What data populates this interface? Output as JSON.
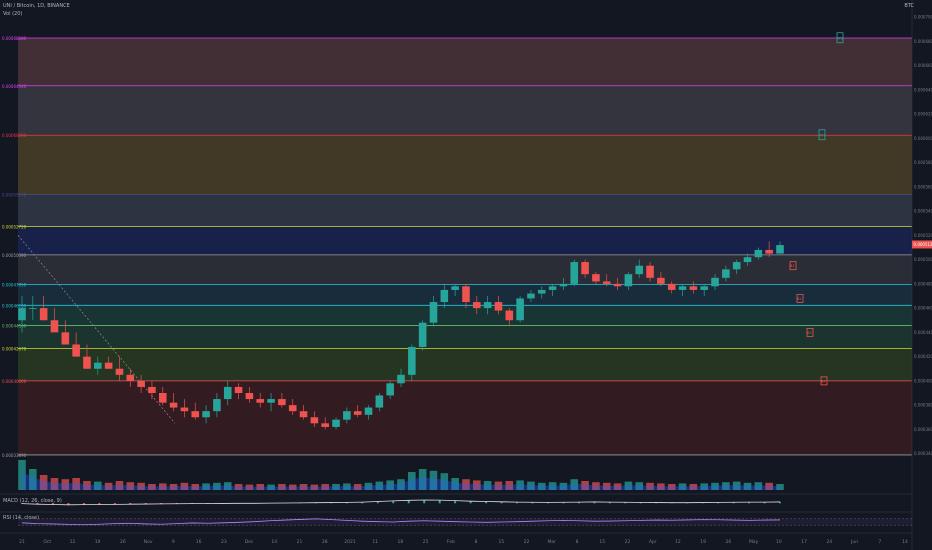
{
  "header": {
    "symbol": "UNI / Bitcoin, 1D, BINANCE",
    "volume_label": "Vol (20)",
    "currency": "BTC"
  },
  "indicators": {
    "macd_label": "MACD (12, 26, close, 9)",
    "rsi_label": "RSI (14, close)"
  },
  "colors": {
    "background": "#131722",
    "up": "#26a69a",
    "down": "#ef5350",
    "signal": "#e0e0e0"
  },
  "chart_data": {
    "type": "candlestick",
    "timeframe": "1D",
    "x_tick_labels": [
      "21",
      "Oct",
      "12",
      "19",
      "26",
      "Nov",
      "9",
      "16",
      "23",
      "Dec",
      "14",
      "21",
      "28",
      "2021",
      "11",
      "18",
      "25",
      "Feb",
      "8",
      "15",
      "22",
      "Mar",
      "8",
      "15",
      "22",
      "Apr",
      "12",
      "19",
      "26",
      "May",
      "10",
      "17",
      "24",
      "Jun",
      "7",
      "14"
    ],
    "y_tick_labels": [
      "0.00070000",
      "0.00068000",
      "0.00066000",
      "0.00064000",
      "0.00062000",
      "0.00060000",
      "0.00058000",
      "0.00056000",
      "0.00054000",
      "0.00052000",
      "0.00050000",
      "0.00048000",
      "0.00046000",
      "0.00044000",
      "0.00042000",
      "0.00040000",
      "0.00038000",
      "0.00036000",
      "0.00034000"
    ],
    "fib_levels": [
      {
        "label": "0.00068280",
        "color": "#e040fb",
        "fill": "#4a3438",
        "value": 0.0006828
      },
      {
        "label": "0.00064340",
        "color": "#e040fb",
        "fill": "#3a3a42",
        "value": 0.0006434
      },
      {
        "label": "0.00060260",
        "color": "#f23645",
        "fill": "#4a3e26",
        "value": 0.0006026
      },
      {
        "label": "0.00055370",
        "color": "#4a4e8c",
        "fill": "#313847",
        "value": 0.0005537
      },
      {
        "label": "0.00052720",
        "color": "#cddc39",
        "fill": "#1a2350",
        "value": 0.0005272
      },
      {
        "label": "0.00050390",
        "color": "#9e9e9e",
        "fill": "#2f3138",
        "value": 0.0005039
      },
      {
        "label": "0.00047950",
        "color": "#26c6da",
        "fill": "#1a3040",
        "value": 0.0004795
      },
      {
        "label": "0.00046230",
        "color": "#26c6da",
        "fill": "#1a3a38",
        "value": 0.0004623
      },
      {
        "label": "0.00044560",
        "color": "#66bb6a",
        "fill": "#1f3a30",
        "value": 0.0004456
      },
      {
        "label": "0.00042670",
        "color": "#cddc39",
        "fill": "#2a3a22",
        "value": 0.0004267
      },
      {
        "label": "0.00040000",
        "color": "#ef5350",
        "fill": "#3a1c22",
        "value": 0.0004
      },
      {
        "label": "0.00033890",
        "color": "#9e9e9e",
        "fill": null,
        "value": 0.0003389
      }
    ],
    "current_price": {
      "label": "0.00051250",
      "tag": "0.00051250"
    },
    "last_price_tag": "0.00050390",
    "green_targets": [
      "TP2",
      "TP1"
    ],
    "red_targets": [
      "B1",
      "B2",
      "B3",
      "B4"
    ],
    "candles": [
      [
        0.00045,
        0.00047,
        0.00044,
        0.00046
      ],
      [
        0.00046,
        0.00047,
        0.00045,
        0.00046
      ],
      [
        0.00046,
        0.00047,
        0.00045,
        0.00045
      ],
      [
        0.00045,
        0.00046,
        0.00044,
        0.00044
      ],
      [
        0.00044,
        0.00045,
        0.00043,
        0.00043
      ],
      [
        0.00043,
        0.00044,
        0.00042,
        0.00042
      ],
      [
        0.00042,
        0.00043,
        0.00041,
        0.00041
      ],
      [
        0.00041,
        0.00042,
        0.000405,
        0.000415
      ],
      [
        0.000415,
        0.00042,
        0.00041,
        0.00041
      ],
      [
        0.00041,
        0.00042,
        0.0004,
        0.000405
      ],
      [
        0.000405,
        0.00041,
        0.000395,
        0.0004
      ],
      [
        0.0004,
        0.000405,
        0.00039,
        0.000395
      ],
      [
        0.000395,
        0.0004,
        0.000385,
        0.00039
      ],
      [
        0.00039,
        0.000395,
        0.00038,
        0.000382
      ],
      [
        0.000382,
        0.00039,
        0.000375,
        0.000378
      ],
      [
        0.000378,
        0.000385,
        0.00037,
        0.000375
      ],
      [
        0.000375,
        0.000382,
        0.000368,
        0.00037
      ],
      [
        0.00037,
        0.00038,
        0.000365,
        0.000375
      ],
      [
        0.000375,
        0.00039,
        0.00037,
        0.000385
      ],
      [
        0.000385,
        0.0004,
        0.00038,
        0.000395
      ],
      [
        0.000395,
        0.000398,
        0.000385,
        0.00039
      ],
      [
        0.00039,
        0.000395,
        0.000382,
        0.000385
      ],
      [
        0.000385,
        0.00039,
        0.000378,
        0.000382
      ],
      [
        0.000382,
        0.00039,
        0.000375,
        0.000385
      ],
      [
        0.000385,
        0.00039,
        0.000378,
        0.00038
      ],
      [
        0.00038,
        0.000385,
        0.000372,
        0.000375
      ],
      [
        0.000375,
        0.00038,
        0.000368,
        0.00037
      ],
      [
        0.00037,
        0.000375,
        0.000362,
        0.000365
      ],
      [
        0.000365,
        0.00037,
        0.00036,
        0.000362
      ],
      [
        0.000362,
        0.00037,
        0.00036,
        0.000368
      ],
      [
        0.000368,
        0.000378,
        0.000365,
        0.000375
      ],
      [
        0.000375,
        0.00038,
        0.00037,
        0.000372
      ],
      [
        0.000372,
        0.00038,
        0.000368,
        0.000378
      ],
      [
        0.000378,
        0.00039,
        0.000375,
        0.000388
      ],
      [
        0.000388,
        0.0004,
        0.000385,
        0.000398
      ],
      [
        0.000398,
        0.00041,
        0.000395,
        0.000405
      ],
      [
        0.000405,
        0.00043,
        0.0004,
        0.000428
      ],
      [
        0.000428,
        0.00045,
        0.000425,
        0.000448
      ],
      [
        0.000448,
        0.00047,
        0.000445,
        0.000465
      ],
      [
        0.000465,
        0.00048,
        0.00046,
        0.000475
      ],
      [
        0.000475,
        0.00048,
        0.00047,
        0.000478
      ],
      [
        0.000478,
        0.00048,
        0.00046,
        0.000465
      ],
      [
        0.000465,
        0.00047,
        0.000455,
        0.00046
      ],
      [
        0.00046,
        0.00047,
        0.000455,
        0.000465
      ],
      [
        0.000465,
        0.00047,
        0.000455,
        0.000458
      ],
      [
        0.000458,
        0.00046,
        0.000445,
        0.00045
      ],
      [
        0.00045,
        0.00047,
        0.000448,
        0.000468
      ],
      [
        0.000468,
        0.000475,
        0.000465,
        0.000472
      ],
      [
        0.000472,
        0.000478,
        0.000468,
        0.000475
      ],
      [
        0.000475,
        0.00048,
        0.00047,
        0.000478
      ],
      [
        0.000478,
        0.000485,
        0.000475,
        0.00048
      ],
      [
        0.00048,
        0.0005,
        0.000478,
        0.000498
      ],
      [
        0.000498,
        0.0005,
        0.000485,
        0.000488
      ],
      [
        0.000488,
        0.00049,
        0.00048,
        0.000482
      ],
      [
        0.000482,
        0.000488,
        0.000478,
        0.00048
      ],
      [
        0.00048,
        0.000485,
        0.000475,
        0.000478
      ],
      [
        0.000478,
        0.00049,
        0.000475,
        0.000488
      ],
      [
        0.000488,
        0.0005,
        0.000485,
        0.000495
      ],
      [
        0.000495,
        0.000498,
        0.000482,
        0.000485
      ],
      [
        0.000485,
        0.00049,
        0.000478,
        0.00048
      ],
      [
        0.00048,
        0.000482,
        0.000472,
        0.000475
      ],
      [
        0.000475,
        0.00048,
        0.00047,
        0.000478
      ],
      [
        0.000478,
        0.000482,
        0.000472,
        0.000475
      ],
      [
        0.000475,
        0.00048,
        0.00047,
        0.000478
      ],
      [
        0.000478,
        0.000488,
        0.000475,
        0.000485
      ],
      [
        0.000485,
        0.000495,
        0.000482,
        0.000492
      ],
      [
        0.000492,
        0.0005,
        0.000488,
        0.000498
      ],
      [
        0.000498,
        0.000505,
        0.000495,
        0.000502
      ],
      [
        0.000502,
        0.00051,
        0.0005,
        0.000508
      ],
      [
        0.000508,
        0.000515,
        0.000502,
        0.000505
      ],
      [
        0.000505,
        0.000515,
        0.000505,
        0.000512
      ]
    ],
    "volume": [
      0.5,
      0.35,
      0.25,
      0.2,
      0.18,
      0.2,
      0.15,
      0.14,
      0.12,
      0.15,
      0.13,
      0.12,
      0.1,
      0.11,
      0.1,
      0.12,
      0.1,
      0.11,
      0.12,
      0.13,
      0.1,
      0.09,
      0.1,
      0.09,
      0.1,
      0.09,
      0.1,
      0.09,
      0.1,
      0.1,
      0.11,
      0.1,
      0.12,
      0.14,
      0.16,
      0.18,
      0.3,
      0.35,
      0.32,
      0.28,
      0.2,
      0.18,
      0.16,
      0.15,
      0.14,
      0.15,
      0.16,
      0.14,
      0.12,
      0.13,
      0.12,
      0.18,
      0.15,
      0.13,
      0.12,
      0.11,
      0.14,
      0.13,
      0.12,
      0.11,
      0.1,
      0.11,
      0.1,
      0.11,
      0.12,
      0.13,
      0.14,
      0.12,
      0.13,
      0.12,
      0.1
    ],
    "macd": [
      -0.2,
      -0.4,
      -0.5,
      -0.6,
      -0.55,
      -0.5,
      -0.45,
      -0.4,
      -0.35,
      -0.3,
      -0.25,
      -0.2,
      -0.2,
      -0.15,
      -0.1,
      -0.1,
      -0.05,
      0,
      0.05,
      0.1,
      0.15,
      0.2,
      0.3,
      0.5,
      0.7,
      0.9,
      1,
      0.95,
      0.8,
      0.6,
      0.5,
      0.4,
      0.3,
      0.25,
      0.2,
      0.25,
      0.3,
      0.35,
      0.3,
      0.25,
      0.2,
      0.15,
      0.1,
      0.1,
      0.15,
      0.2,
      0.25,
      0.3,
      0.3,
      0.35
    ],
    "rsi": [
      45,
      40,
      38,
      35,
      33,
      36,
      40,
      42,
      38,
      36,
      40,
      44,
      42,
      45,
      48,
      52,
      58,
      62,
      66,
      70,
      65,
      60,
      55,
      52,
      50,
      55,
      58,
      55,
      52,
      50,
      48,
      50,
      52,
      55,
      58,
      60,
      58,
      55,
      56,
      58,
      60,
      62,
      61,
      63,
      65,
      64,
      62,
      60,
      62,
      63
    ]
  }
}
